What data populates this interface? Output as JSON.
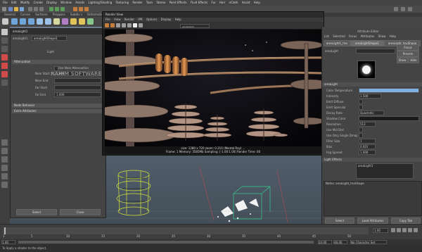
{
  "menubar": {
    "items": [
      "File",
      "Edit",
      "Modify",
      "Create",
      "Display",
      "Window",
      "Assets",
      "Lighting/Shading",
      "Texturing",
      "Render",
      "Toon",
      "Stereo",
      "Paint Effects",
      "Fluid Effects",
      "Fur",
      "Hair",
      "nCloth",
      "Assist",
      "Help"
    ]
  },
  "shelf": {
    "tabs": [
      "General",
      "Curves",
      "Surfaces",
      "Polygons",
      "Subdiv s",
      "Deformation"
    ]
  },
  "attr_editor": {
    "title": "areaLight1",
    "node_label": "areaLight1",
    "node_tab": "areaLightShape1",
    "light_caption": "Light",
    "section_attenuation": "Attenuation",
    "rows": [
      {
        "label": "Near Start",
        "value": "1.000"
      },
      {
        "label": "Near End",
        "value": ""
      },
      {
        "label": "Far Start",
        "value": ""
      },
      {
        "label": "Far End",
        "value": "1.000"
      }
    ],
    "check_label": "Use Near Attenuation",
    "section_node": "Node Behavior",
    "section_extra": "Extra Attributes",
    "select_label": "Select",
    "close_label": "Close"
  },
  "render_view": {
    "title": "Render View",
    "menu": [
      "File",
      "View",
      "Render",
      "IPR",
      "Options",
      "Display",
      "Help"
    ],
    "camera_select": "renderCam",
    "status_line1": "size: 1280 x 720  zoom: 0.210       (Mental Ray) ...",
    "status_line2": "Frame: 1    Memory: 3585Mb    Sampling: [-1.00:1.00]   Render Time: 00"
  },
  "watermark": "RAHIM SOFTWARE",
  "right_panel": {
    "title": "Attribute Editor",
    "tabs": [
      "List",
      "Selected",
      "Focus",
      "Attributes",
      "Show",
      "Help"
    ],
    "node_tabs": [
      "areaLight1_hsv",
      "areaLightShape1",
      "areaLight_hsvShape"
    ],
    "type_label": "areaLight",
    "section": "areaLight",
    "focus_label": "Focus",
    "presets_label": "Presets",
    "show_label": "Show",
    "hide_label": "Hide",
    "fields": [
      {
        "label": "Color Temperature",
        "value": ""
      },
      {
        "label": "Intensity",
        "value": "1.500"
      },
      {
        "label": "Emit Diffuse",
        "value": ""
      },
      {
        "label": "Emit Specular",
        "value": ""
      },
      {
        "label": "Decay Rate",
        "value": "Quadratic"
      },
      {
        "label": "Shadow Color",
        "value": ""
      },
      {
        "label": "Resolution",
        "value": "512"
      },
      {
        "label": "Use Mid Dist",
        "value": ""
      },
      {
        "label": "Use Only Single Dmap",
        "value": ""
      },
      {
        "label": "Filter Size",
        "value": "1"
      },
      {
        "label": "Bias",
        "value": "0.001"
      },
      {
        "label": "Fog Spread",
        "value": "1.000"
      }
    ],
    "section2": "Light Effects",
    "light_item": "areaLight1",
    "notes_label": "Notes: areaLight_hsvShape",
    "bottom_buttons": [
      "Select",
      "Load Attributes",
      "Copy Tab"
    ]
  },
  "timeline": {
    "ticks": [
      "1",
      "5",
      "10",
      "15",
      "20",
      "25",
      "30",
      "35",
      "40",
      "45",
      "50"
    ],
    "current": "1.00"
  },
  "range": {
    "start": "1.00",
    "end": "24.00",
    "end2": "48.00",
    "char_set": "No Character Set"
  },
  "help": {
    "text": "To Apply a shader to the object."
  },
  "colors": {
    "ui_bg": "#3a3a3a",
    "panel": "#444444",
    "viewport": "#5a6a7a",
    "selection": "#ffd800"
  }
}
